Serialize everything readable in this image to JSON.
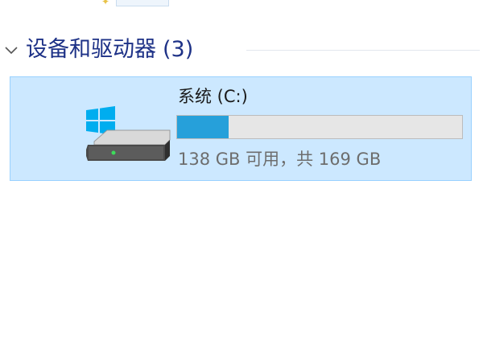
{
  "group": {
    "title": "设备和驱动器",
    "count": "(3)"
  },
  "drive": {
    "name": "系统 (C:)",
    "space_text": "138 GB 可用，共 169 GB",
    "free_gb": 138,
    "total_gb": 169,
    "used_fraction": 0.18,
    "icon": "hard-drive-windows-icon"
  },
  "colors": {
    "selection_bg": "#cce8ff",
    "selection_border": "#99d1ff",
    "usage_fill": "#26a0da",
    "usage_track": "#e6e6e6",
    "header_text": "#1e3287",
    "windows_logo": "#00adef"
  }
}
